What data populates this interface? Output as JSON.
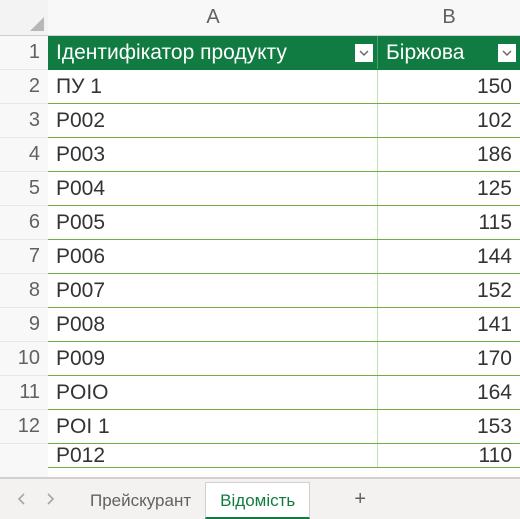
{
  "columns": {
    "a": "A",
    "b": "B"
  },
  "header": {
    "col_a": "Ідентифікатор продукту",
    "col_b": "Біржова"
  },
  "rows": [
    {
      "n": "1"
    },
    {
      "n": "2",
      "a": "ПУ 1",
      "b": "150"
    },
    {
      "n": "3",
      "a": "P002",
      "b": "102"
    },
    {
      "n": "4",
      "a": "P003",
      "b": "186"
    },
    {
      "n": "5",
      "a": "P004",
      "b": "125"
    },
    {
      "n": "6",
      "a": "P005",
      "b": "115"
    },
    {
      "n": "7",
      "a": "P006",
      "b": "144"
    },
    {
      "n": "8",
      "a": "P007",
      "b": "152"
    },
    {
      "n": "9",
      "a": "P008",
      "b": "141"
    },
    {
      "n": "10",
      "a": "P009",
      "b": "170"
    },
    {
      "n": "11",
      "a": "POIO",
      "b": "164"
    },
    {
      "n": "12",
      "a": "POI 1",
      "b": "153"
    }
  ],
  "partial_row": {
    "a": "P012",
    "b": "110"
  },
  "tabs": {
    "prev": "‹",
    "next": "›",
    "tab1": "Прейскурант",
    "tab2": "Відомість",
    "add": "+"
  }
}
